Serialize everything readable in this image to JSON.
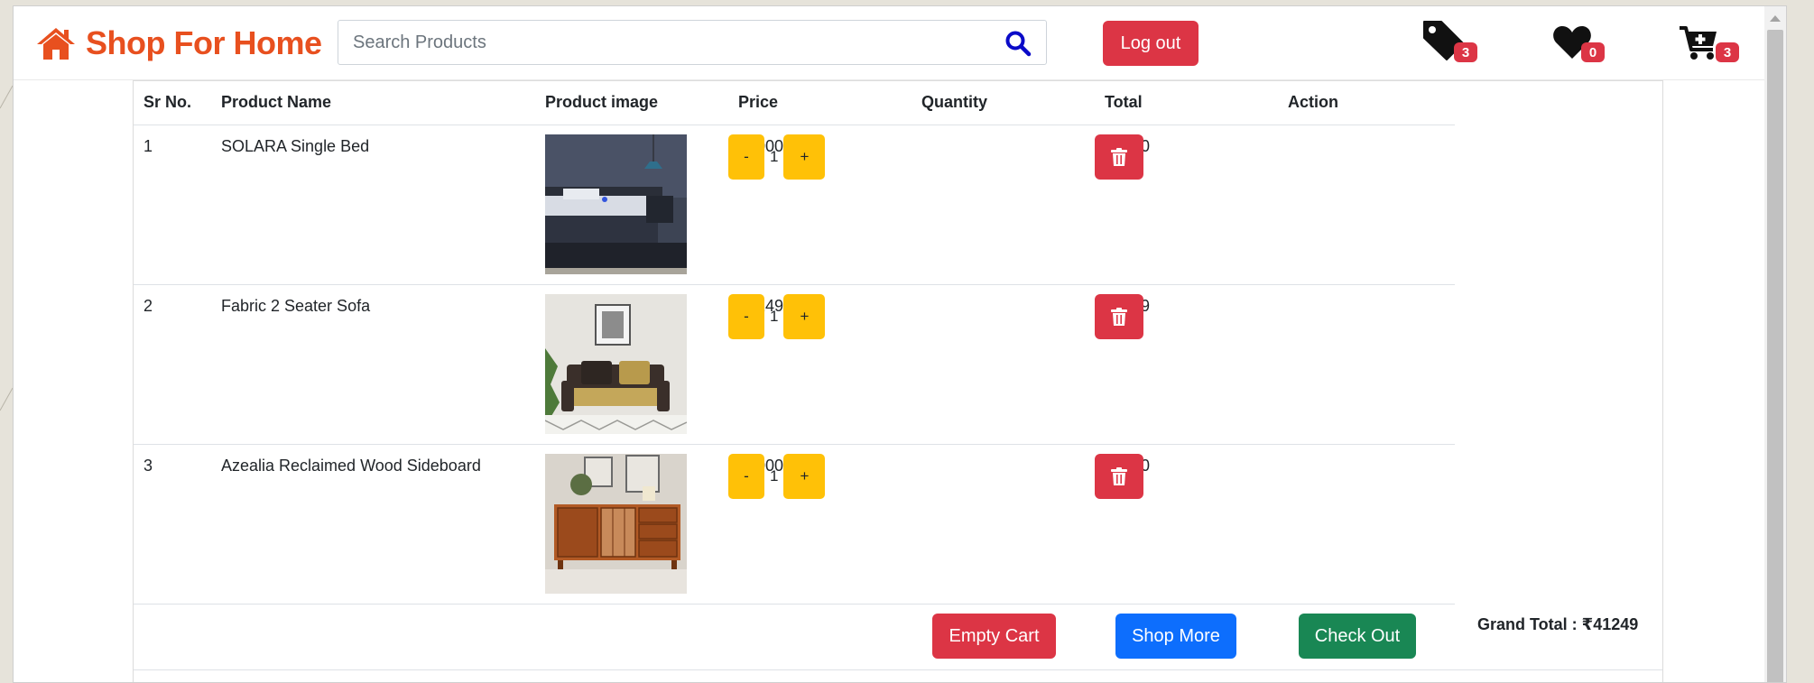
{
  "brand": {
    "name": "Shop For Home",
    "color": "#e8501f"
  },
  "search": {
    "placeholder": "Search Products",
    "value": ""
  },
  "nav": {
    "logout_label": "Log out",
    "tags_count": "3",
    "wishlist_count": "0",
    "cart_count": "3"
  },
  "table": {
    "headers": [
      "Sr No.",
      "Product Name",
      "Product image",
      "Price",
      "Quantity",
      "Total",
      "Action"
    ],
    "rows": [
      {
        "sr": "1",
        "name": "SOLARA Single Bed",
        "image": "bed",
        "price": "15000",
        "quantity": "1",
        "total": "15000"
      },
      {
        "sr": "2",
        "name": "Fabric 2 Seater Sofa",
        "image": "sofa",
        "price": "14249",
        "quantity": "1",
        "total": "14249"
      },
      {
        "sr": "3",
        "name": "Azealia Reclaimed Wood Sideboard",
        "image": "sideboard",
        "price": "12000",
        "quantity": "1",
        "total": "12000"
      }
    ],
    "minus_label": "-",
    "plus_label": "+"
  },
  "footer": {
    "empty_cart_label": "Empty Cart",
    "shop_more_label": "Shop More",
    "checkout_label": "Check Out",
    "grand_total": "Grand Total : ₹41249"
  },
  "colors": {
    "danger": "#dc3545",
    "warning": "#ffc107",
    "primary": "#0d6efd",
    "success": "#198754",
    "search_icon": "#0a0ac8"
  }
}
